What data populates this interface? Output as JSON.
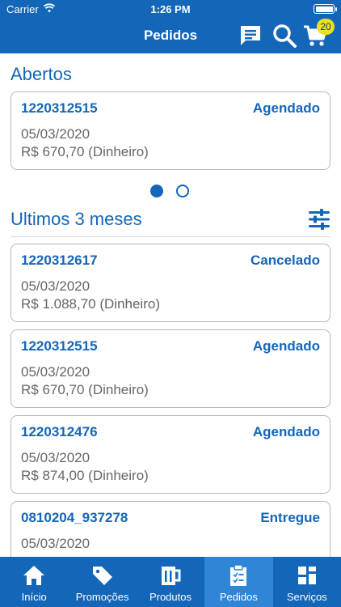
{
  "status_bar": {
    "carrier": "Carrier",
    "time": "1:26 PM"
  },
  "header": {
    "title": "Pedidos",
    "cart_count": "20"
  },
  "sections": {
    "open_title": "Abertos",
    "recent_title": "Ultimos 3 meses"
  },
  "open_orders": [
    {
      "id": "1220312515",
      "status": "Agendado",
      "date": "05/03/2020",
      "price": "R$ 670,70 (Dinheiro)"
    }
  ],
  "recent_orders": [
    {
      "id": "1220312617",
      "status": "Cancelado",
      "date": "05/03/2020",
      "price": "R$ 1.088,70 (Dinheiro)"
    },
    {
      "id": "1220312515",
      "status": "Agendado",
      "date": "05/03/2020",
      "price": "R$ 670,70 (Dinheiro)"
    },
    {
      "id": "1220312476",
      "status": "Agendado",
      "date": "05/03/2020",
      "price": "R$ 874,00 (Dinheiro)"
    },
    {
      "id": "0810204_937278",
      "status": "Entregue",
      "date": "05/03/2020",
      "price": ""
    }
  ],
  "pagination": {
    "total": 2,
    "active": 0
  },
  "tabbar": {
    "items": [
      {
        "label": "Início",
        "icon": "home-icon"
      },
      {
        "label": "Promoções",
        "icon": "tag-icon"
      },
      {
        "label": "Produtos",
        "icon": "mug-icon"
      },
      {
        "label": "Pedidos",
        "icon": "clipboard-icon",
        "active": true
      },
      {
        "label": "Serviços",
        "icon": "grid-icon"
      }
    ]
  },
  "colors": {
    "primary": "#1466b8",
    "active_tab": "#2f85d6",
    "badge": "#e8e21f",
    "card_border": "#b9b9b9",
    "muted_text": "#666666"
  }
}
